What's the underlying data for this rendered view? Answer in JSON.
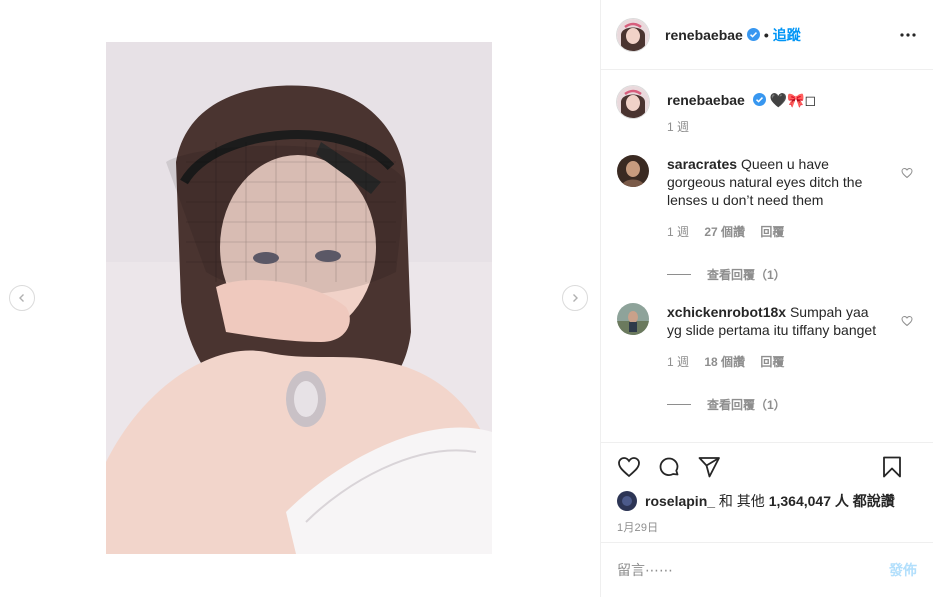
{
  "post": {
    "username": "renebaebae",
    "follow_label": "追蹤",
    "dot": "•",
    "more_icon": "more-horizontal-icon"
  },
  "caption": {
    "username": "renebaebae",
    "text": "🖤🎀◻",
    "time": "1 週"
  },
  "comments": [
    {
      "username": "saracrates",
      "text": "Queen u have gorgeous natural eyes ditch the lenses u don’t need them",
      "time": "1 週",
      "likes": "27 個讚",
      "reply": "回覆",
      "view_replies": "查看回覆（1）"
    },
    {
      "username": "xchickenrobot18x",
      "text": "Sumpah yaa yg slide pertama itu tiffany banget",
      "time": "1 週",
      "likes": "18 個讚",
      "reply": "回覆",
      "view_replies": "查看回覆（1）"
    }
  ],
  "likes": {
    "user": "roselapin_",
    "connector": "和 其他",
    "count": "1,364,047",
    "suffix": "人 都說讚"
  },
  "date": "1月29日",
  "add_comment": {
    "placeholder": "留言⋯⋯",
    "post_label": "發佈"
  },
  "colors": {
    "accent": "#0095f6",
    "muted": "#8e8e8e",
    "border": "#efefef",
    "post_disabled": "#b2dffc",
    "verified": "#3897f0"
  },
  "icons": [
    "chevron-left-icon",
    "chevron-right-icon",
    "verified-badge-icon",
    "heart-icon",
    "comment-icon",
    "share-icon",
    "bookmark-icon"
  ]
}
